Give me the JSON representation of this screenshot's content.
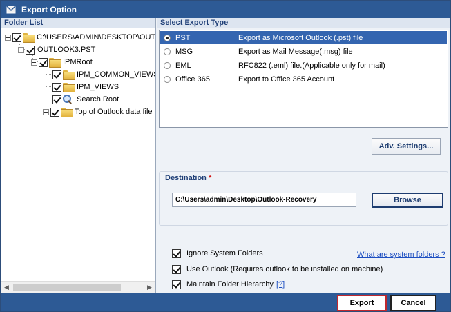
{
  "window": {
    "title": "Export Option"
  },
  "folder_list": {
    "header": "Folder List",
    "items": [
      {
        "label": "C:\\USERS\\ADMIN\\DESKTOP\\OUTLOOK",
        "checked": true,
        "expanded": true,
        "icon": "open-folder-icon"
      },
      {
        "label": "OUTLOOK3.PST",
        "checked": true,
        "expanded": true,
        "icon": ""
      },
      {
        "label": "IPMRoot",
        "checked": true,
        "expanded": true,
        "icon": "folder-icon"
      },
      {
        "label": "IPM_COMMON_VIEWS",
        "checked": true,
        "icon": "folder-icon"
      },
      {
        "label": "IPM_VIEWS",
        "checked": true,
        "icon": "folder-icon"
      },
      {
        "label": "Search Root",
        "checked": true,
        "icon": "search-icon"
      },
      {
        "label": "Top of Outlook data file",
        "checked": true,
        "expanded": false,
        "icon": "folder-icon"
      }
    ]
  },
  "export_type": {
    "header": "Select Export Type",
    "options": [
      {
        "name": "PST",
        "description": "Export as Microsoft Outlook (.pst) file",
        "selected": true
      },
      {
        "name": "MSG",
        "description": "Export as Mail Message(.msg) file",
        "selected": false
      },
      {
        "name": "EML",
        "description": "RFC822 (.eml) file.(Applicable only for mail)",
        "selected": false
      },
      {
        "name": "Office 365",
        "description": "Export to Office 365 Account",
        "selected": false
      }
    ]
  },
  "adv_settings": {
    "label": "Adv. Settings..."
  },
  "destination": {
    "label": "Destination",
    "required_mark": "*",
    "path": "C:\\Users\\admin\\Desktop\\Outlook-Recovery",
    "browse_label": "Browse"
  },
  "options": {
    "ignore_system_folders": {
      "label": "Ignore System Folders",
      "checked": true
    },
    "system_folders_link": "What are system folders ?",
    "use_outlook": {
      "label": "Use Outlook (Requires outlook to be installed on machine)",
      "checked": true
    },
    "maintain_hierarchy": {
      "label": "Maintain Folder Hierarchy",
      "checked": true
    },
    "help_link": "[?]"
  },
  "footer": {
    "export_label": "Export",
    "cancel_label": "Cancel"
  },
  "colors": {
    "title_bar": "#2d5a95",
    "selection": "#3465b0",
    "header_text": "#1f3f77",
    "export_border": "#c0282e",
    "required": "#d01010"
  }
}
